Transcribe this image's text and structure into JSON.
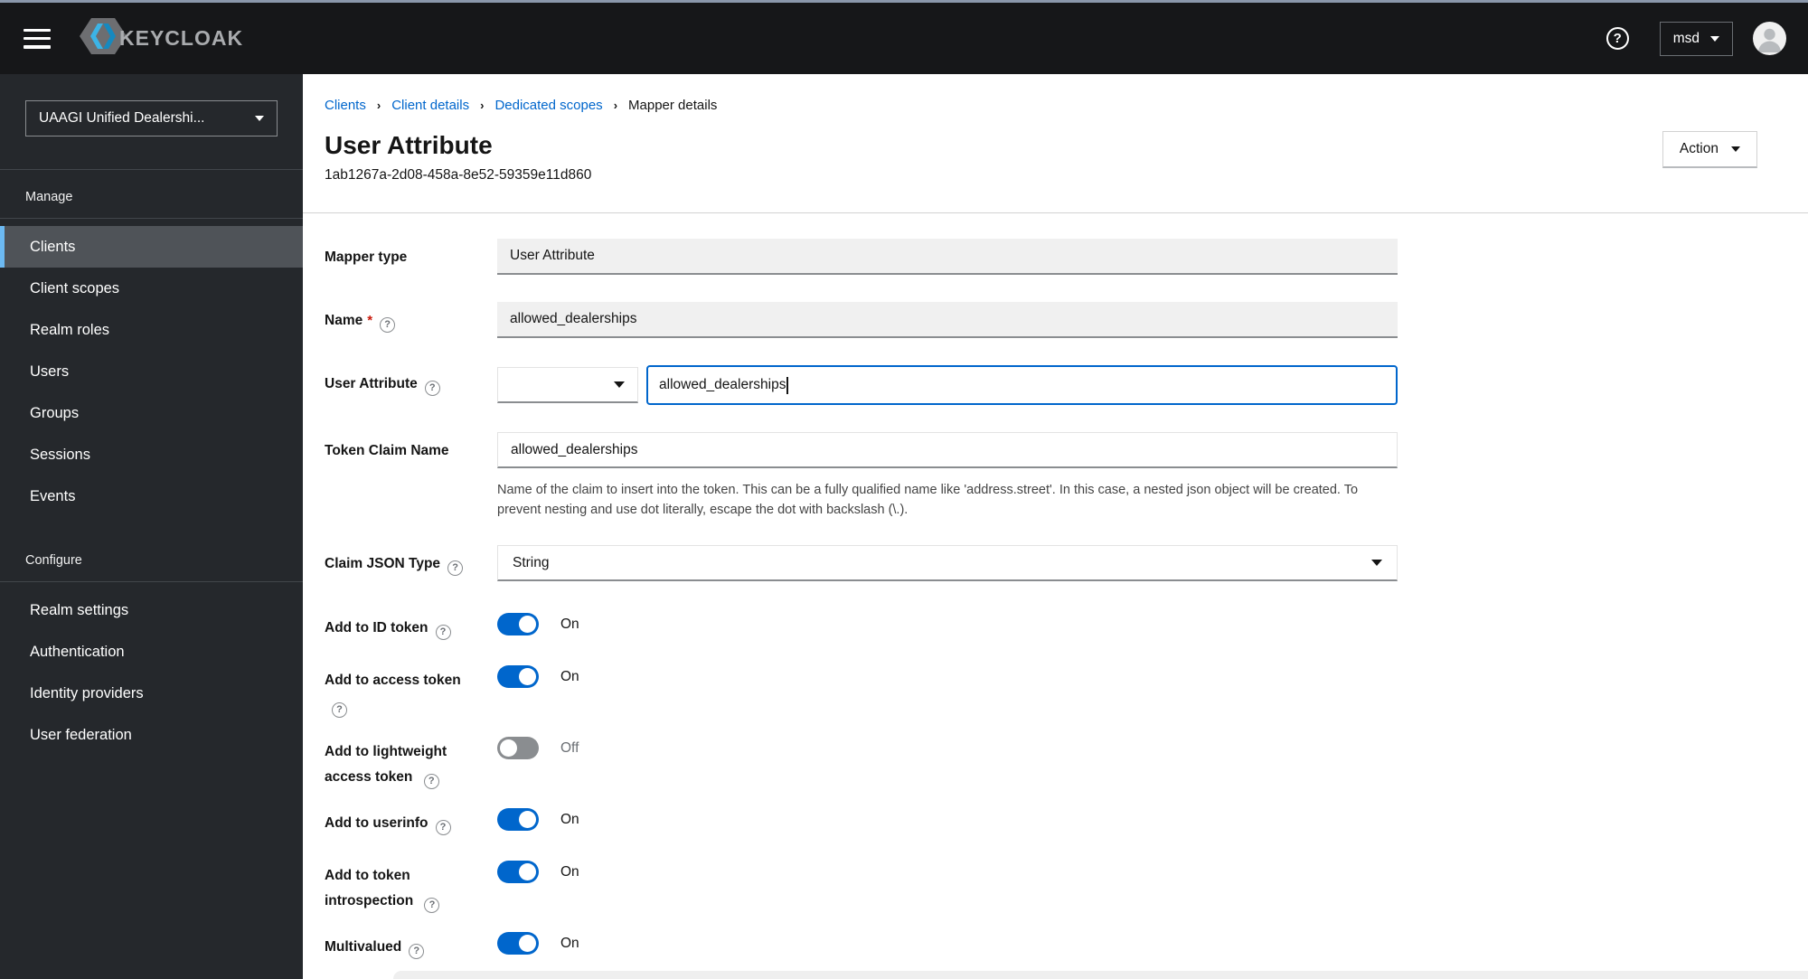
{
  "header": {
    "brand_text": "KEYCLOAK",
    "user_menu_label": "msd"
  },
  "sidebar": {
    "realm_selector": {
      "label": "UAAGI Unified Dealershi..."
    },
    "groups": [
      {
        "label": "Manage",
        "items": [
          {
            "label": "Clients",
            "active": true
          },
          {
            "label": "Client scopes",
            "active": false
          },
          {
            "label": "Realm roles",
            "active": false
          },
          {
            "label": "Users",
            "active": false
          },
          {
            "label": "Groups",
            "active": false
          },
          {
            "label": "Sessions",
            "active": false
          },
          {
            "label": "Events",
            "active": false
          }
        ]
      },
      {
        "label": "Configure",
        "items": [
          {
            "label": "Realm settings",
            "active": false
          },
          {
            "label": "Authentication",
            "active": false
          },
          {
            "label": "Identity providers",
            "active": false
          },
          {
            "label": "User federation",
            "active": false
          }
        ]
      }
    ]
  },
  "breadcrumb": {
    "items": [
      {
        "label": "Clients",
        "link": true
      },
      {
        "label": "Client details",
        "link": true
      },
      {
        "label": "Dedicated scopes",
        "link": true
      },
      {
        "label": "Mapper details",
        "link": false
      }
    ]
  },
  "page": {
    "title": "User Attribute",
    "subtitle": "1ab1267a-2d08-458a-8e52-59359e11d860",
    "action_button_label": "Action"
  },
  "form": {
    "mapper_type": {
      "label": "Mapper type",
      "value": "User Attribute",
      "disabled": true
    },
    "name": {
      "label": "Name",
      "required": "*",
      "value": "allowed_dealerships",
      "disabled": true
    },
    "user_attribute": {
      "label": "User Attribute",
      "value": "allowed_dealerships",
      "focused": true,
      "dropdown_value": ""
    },
    "token_claim_name": {
      "label": "Token Claim Name",
      "value": "allowed_dealerships",
      "help_text": "Name of the claim to insert into the token. This can be a fully qualified name like 'address.street'. In this case, a nested json object will be created. To prevent nesting and use dot literally, escape the dot with backslash (\\.)."
    },
    "claim_json_type": {
      "label": "Claim JSON Type",
      "value": "String"
    },
    "toggles": [
      {
        "label": "Add to ID token",
        "state": "On",
        "on": true
      },
      {
        "label": "Add to access token",
        "state": "On",
        "on": true
      },
      {
        "label": "Add to lightweight access token",
        "state": "Off",
        "on": false
      },
      {
        "label": "Add to userinfo",
        "state": "On",
        "on": true
      },
      {
        "label": "Add to token introspection",
        "state": "On",
        "on": true
      },
      {
        "label": "Multivalued",
        "state": "On",
        "on": true
      }
    ]
  },
  "colors": {
    "accent_blue": "#0066cc",
    "breadcrumb_link": "#0066cc",
    "toggle_on": "#0066cc",
    "toggle_off": "#8a8d90",
    "sidebar_active_indicator": "#6cb9f2",
    "masthead_bg": "#161719",
    "sidebar_bg": "#25282c",
    "required_red": "#c9190b"
  }
}
